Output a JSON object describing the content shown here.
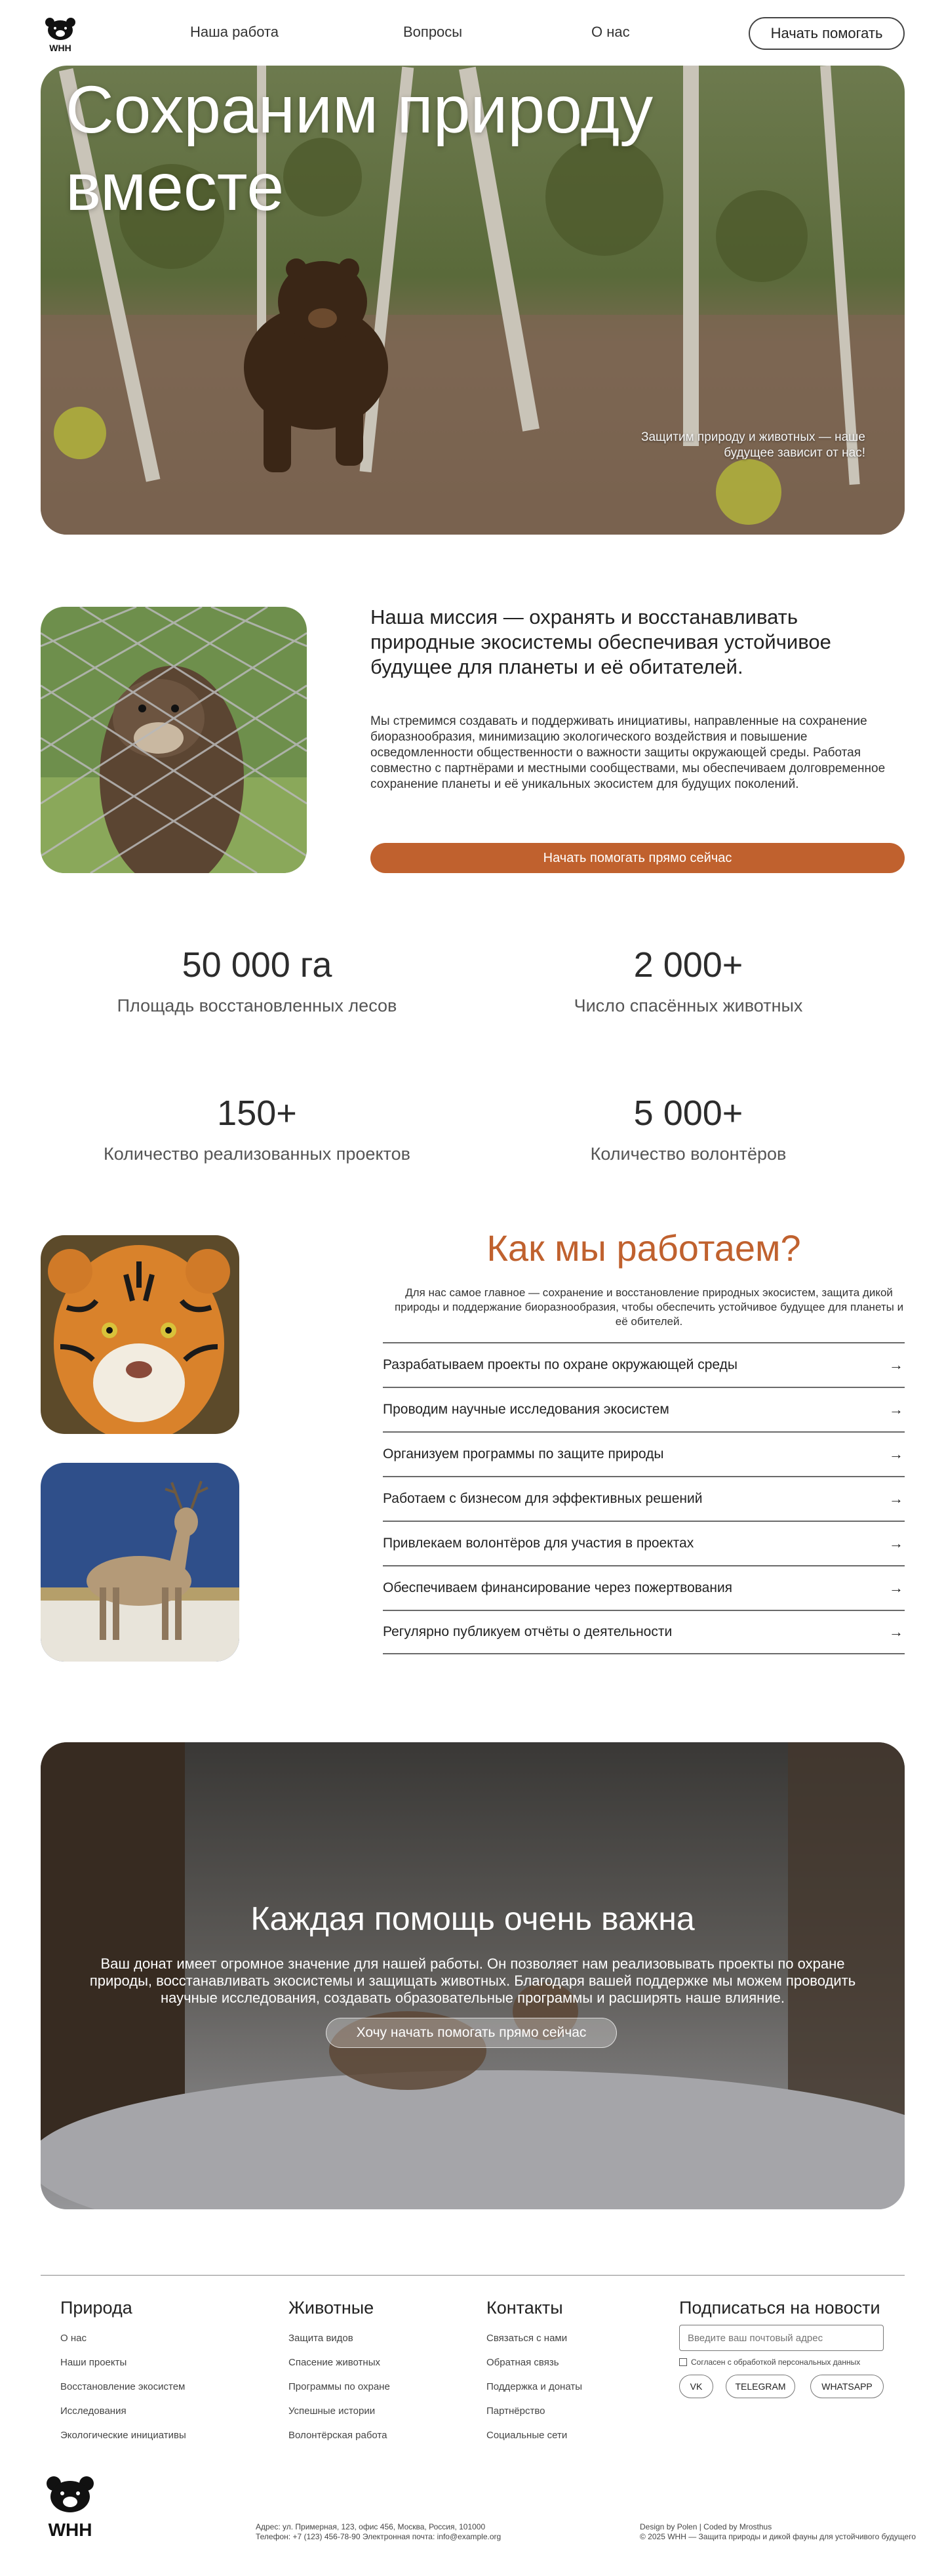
{
  "brand": {
    "name": "WHH"
  },
  "nav": {
    "links": [
      "Наша работа",
      "Вопросы",
      "О нас"
    ],
    "cta": "Начать помогать"
  },
  "hero": {
    "title_line1": "Сохраним природу",
    "title_line2": "вместе",
    "note": "Защитим природу и животных — наше будущее зависит от нас!"
  },
  "mission": {
    "heading": "Наша миссия — охранять и восстанавливать природные экосистемы обеспечивая устойчивое будущее для планеты и её обитателей.",
    "body": "Мы стремимся создавать и поддерживать инициативы, направленные на сохранение биоразнообразия, минимизацию экологического воздействия и повышение осведомленности общественности о важности защиты окружающей среды. Работая совместно с партнёрами и местными сообществами, мы обеспечиваем долговременное сохранение планеты и её уникальных экосистем для будущих поколений.",
    "cta": "Начать помогать прямо сейчас"
  },
  "stats": [
    {
      "value": "50 000 га",
      "label": "Площадь восстановленных лесов"
    },
    {
      "value": "2 000+",
      "label": "Число спасённых животных"
    },
    {
      "value": "150+",
      "label": "Количество реализованных проектов"
    },
    {
      "value": "5 000+",
      "label": "Количество волонтёров"
    }
  ],
  "work": {
    "title": "Как мы работаем?",
    "description": "Для нас самое главное — сохранение и восстановление природных экосистем, защита дикой природы и поддержание биоразнообразия, чтобы обеспечить устойчивое будущее для планеты и её обителей.",
    "items": [
      "Разрабатываем проекты по охране окружающей среды",
      "Проводим научные исследования экосистем",
      "Организуем программы по защите природы",
      "Работаем с бизнесом для эффективных решений",
      "Привлекаем волонтёров для участия в проектах",
      "Обеспечиваем финансирование через пожертвования",
      "Регулярно публикуем отчёты о деятельности"
    ],
    "arrow": "→"
  },
  "donate": {
    "title": "Каждая помощь очень важна",
    "text": "Ваш донат имеет огромное значение для нашей работы. Он позволяет нам реализовывать проекты по охране природы, восстанавливать экосистемы и защищать животных. Благодаря вашей поддержке мы можем проводить научные исследования, создавать образовательные программы и расширять наше влияние.",
    "cta": "Хочу начать помогать прямо сейчас"
  },
  "footer": {
    "columns": [
      {
        "title": "Природа",
        "links": [
          "О нас",
          "Наши проекты",
          "Восстановление экосистем",
          "Исследования",
          "Экологические инициативы"
        ]
      },
      {
        "title": "Животные",
        "links": [
          "Защита видов",
          "Спасение животных",
          "Программы по охране",
          "Успешные истории",
          "Волонтёрская работа"
        ]
      },
      {
        "title": "Контакты",
        "links": [
          "Связаться с нами",
          "Обратная связь",
          "Поддержка и донаты",
          "Партнёрство",
          "Социальные сети"
        ]
      }
    ],
    "subscribe": {
      "title": "Подписаться на новости",
      "placeholder": "Введите ваш почтовый адрес",
      "consent": "Согласен с обработкой персональных данных",
      "socials": [
        "VK",
        "TELEGRAM",
        "WHATSAPP"
      ]
    },
    "address": "Адрес: ул. Примерная, 123, офис 456, Москва, Россия, 101000",
    "phone": "Телефон: +7 (123) 456-78-90 Электронная почта: info@example.org",
    "credits": "Design by Polen | Coded by Mrosthus",
    "copyright": "© 2025 WHH — Защита природы и дикой фауны для устойчивого будущего"
  }
}
